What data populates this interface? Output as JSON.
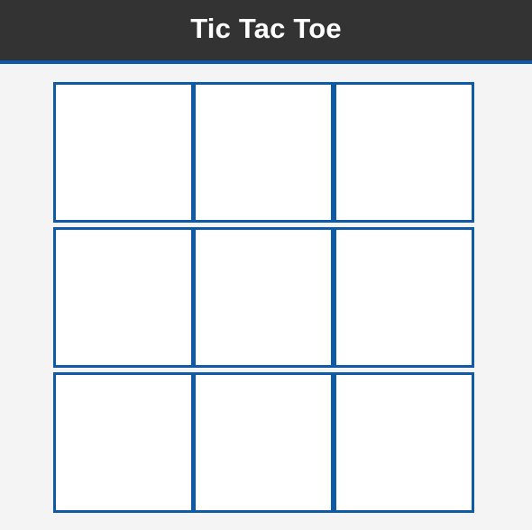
{
  "header": {
    "title": "Tic Tac Toe"
  },
  "board": {
    "cells": [
      "",
      "",
      "",
      "",
      "",
      "",
      "",
      "",
      ""
    ]
  },
  "colors": {
    "header_bg": "#333333",
    "accent": "#0e5aa7",
    "page_bg": "#f4f4f4",
    "cell_bg": "#ffffff"
  }
}
